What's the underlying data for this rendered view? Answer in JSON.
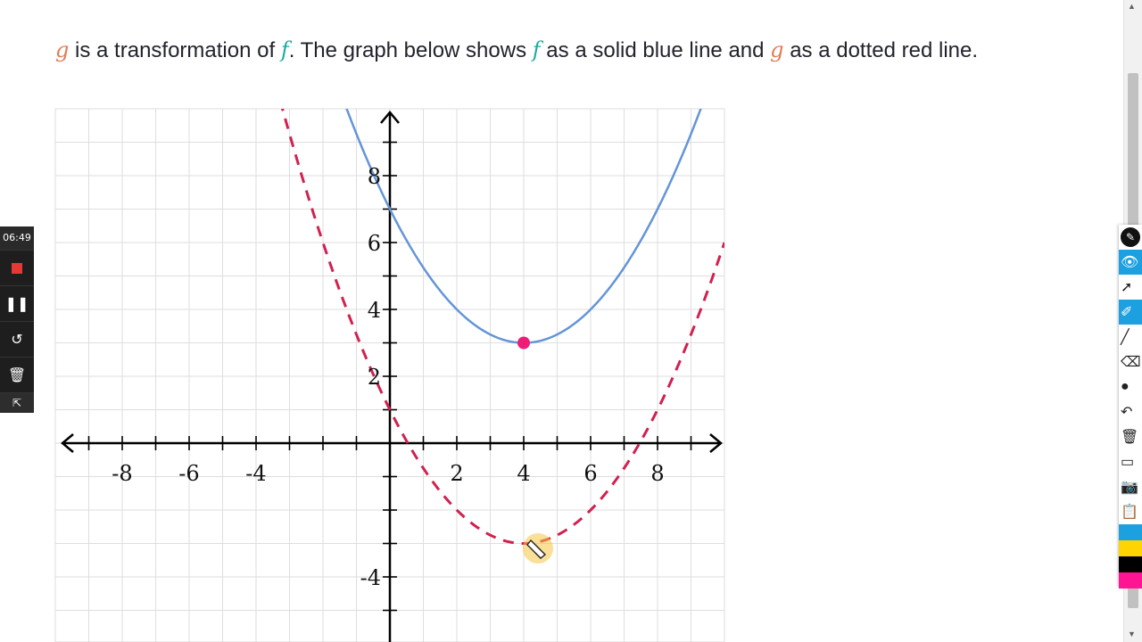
{
  "prompt": {
    "var_g": "g",
    "seg1": " is a transformation of ",
    "var_f": "f",
    "seg2": ". The graph below shows ",
    "var_f2": "f",
    "seg3": " as a solid blue line and ",
    "var_g2": "g",
    "seg4": " as a dotted red line."
  },
  "chart_data": {
    "type": "line",
    "xlim": [
      -10,
      10
    ],
    "ylim": [
      -6,
      10
    ],
    "grid": true,
    "x_ticks": [
      -8,
      -6,
      -4,
      2,
      4,
      6,
      8
    ],
    "y_ticks": [
      8,
      6,
      4,
      2,
      -4
    ],
    "series": [
      {
        "style": "solid",
        "color": "#6495d7",
        "vertex": [
          4,
          3
        ],
        "a": 0.25
      },
      {
        "style": "dashed",
        "color": "#d0214f",
        "vertex": [
          4,
          -3
        ],
        "a": 0.25
      }
    ],
    "points": [
      {
        "x": 4,
        "y": 3,
        "color": "#ee1c78"
      }
    ]
  },
  "recorder": {
    "timer": "06:49",
    "stop_icon": "stop-icon",
    "pause_icon": "pause-icon",
    "restart_icon": "restart-icon",
    "trash_icon": "trash-icon",
    "expand_icon": "expand-icon"
  },
  "toolbar": {
    "icons": [
      "pen-logo-icon",
      "eye-icon",
      "cursor-icon",
      "highlighter-icon",
      "line-icon",
      "eraser-icon",
      "dot-icon",
      "undo-icon",
      "trash-icon",
      "whiteboard-icon",
      "camera-icon",
      "clipboard-icon"
    ],
    "colors": [
      "#1ca0e0",
      "#ffd400",
      "#000000",
      "#ff1493"
    ]
  }
}
